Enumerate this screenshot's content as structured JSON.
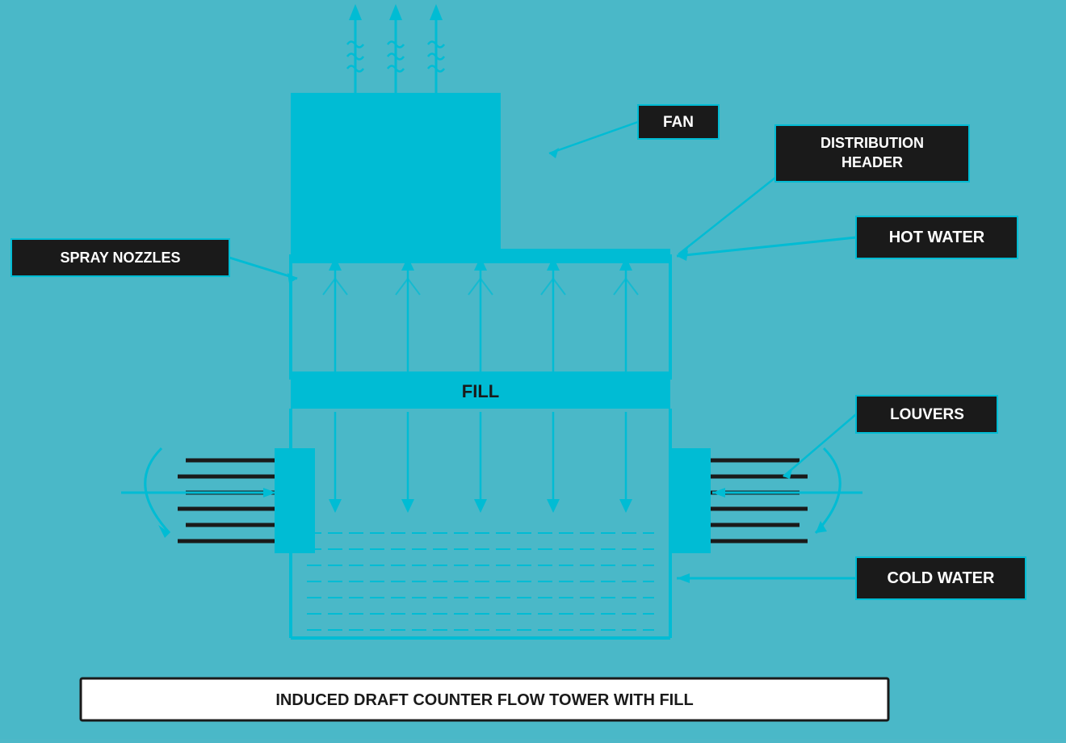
{
  "labels": {
    "fan": "FAN",
    "distribution_header": "DISTRIBUTION\nHEADER",
    "hot_water": "HOT WATER",
    "spray_nozzles": "SPRAY NOZZLES",
    "fill": "FILL",
    "louvers": "LOUVERS",
    "cold_water": "COLD WATER",
    "caption": "INDUCED DRAFT COUNTER FLOW TOWER WITH FILL"
  },
  "colors": {
    "background": "#4db8c8",
    "cyan": "#00bcd4",
    "black": "#1a1a1a",
    "white": "#ffffff"
  }
}
